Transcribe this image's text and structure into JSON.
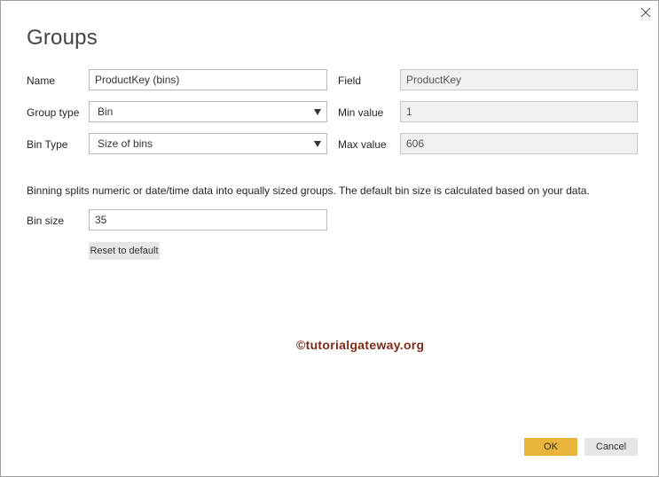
{
  "dialog": {
    "title": "Groups",
    "close_icon": "close-icon"
  },
  "form": {
    "name_label": "Name",
    "name_value": "ProductKey (bins)",
    "field_label": "Field",
    "field_value": "ProductKey",
    "group_type_label": "Group type",
    "group_type_value": "Bin",
    "min_value_label": "Min value",
    "min_value": "1",
    "bin_type_label": "Bin Type",
    "bin_type_value": "Size of bins",
    "max_value_label": "Max value",
    "max_value": "606",
    "info_text": "Binning splits numeric or date/time data into equally sized groups. The default bin size is calculated based on your data.",
    "bin_size_label": "Bin size",
    "bin_size_value": "35",
    "reset_label": "Reset to default"
  },
  "watermark": "©tutorialgateway.org",
  "buttons": {
    "ok_label": "OK",
    "cancel_label": "Cancel"
  },
  "colors": {
    "ok_accent": "#e8b43b",
    "watermark": "#7a2c1c"
  }
}
